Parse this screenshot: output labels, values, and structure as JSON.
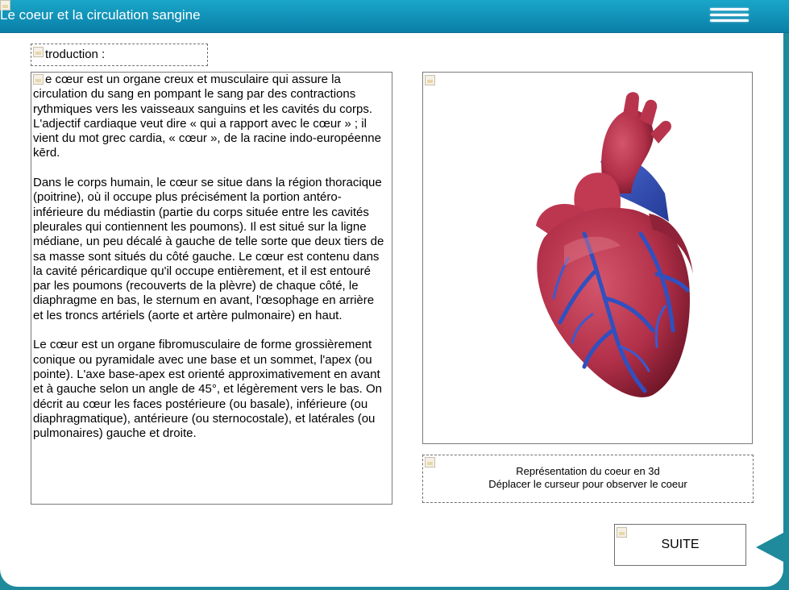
{
  "header": {
    "title": "Le coeur et la circulation sangine"
  },
  "intro": {
    "label": "troduction :"
  },
  "body_text": {
    "p1": "e cœur est un organe creux et musculaire qui assure la circulation du sang en pompant le sang par des contractions rythmiques vers les vaisseaux sanguins et les cavités du corps. L'adjectif cardiaque veut dire « qui a rapport avec le cœur » ; il vient du mot grec cardia, « cœur », de la racine indo-européenne kērd.",
    "p2": "Dans le corps humain, le cœur se situe dans la région thoracique (poitrine), où il occupe plus précisément la portion antéro-inférieure du médiastin (partie du corps située entre les cavités pleurales qui contiennent les poumons). Il est situé sur la ligne médiane, un peu décalé à gauche de telle sorte que deux tiers de sa masse sont situés du côté gauche. Le cœur est contenu dans la cavité péricardique qu'il occupe entièrement, et il est entouré par les poumons (recouverts de la plèvre) de chaque côté, le diaphragme en bas, le sternum en avant, l'œsophage en arrière et les troncs artériels (aorte et artère pulmonaire) en haut.",
    "p3": "Le cœur est un organe fibromusculaire de forme grossièrement conique ou pyramidale avec une base et un sommet, l'apex (ou pointe). L'axe base-apex est orienté approximativement en avant et à gauche selon un angle de 45°, et légèrement vers le bas. On décrit au cœur les faces postérieure (ou basale), inférieure (ou diaphragmatique), antérieure (ou sternocostale), et latérales (ou pulmonaires) gauche et droite."
  },
  "caption": {
    "line1": "Représentation du coeur en 3d",
    "line2": "Déplacer le curseur pour observer le coeur"
  },
  "navigation": {
    "suite_label": "SUITE"
  },
  "colors": {
    "header": "#0a8fb8",
    "background": "#1e8a9c",
    "heart_muscle": "#b5344c",
    "heart_vessels": "#2f4fb8"
  }
}
